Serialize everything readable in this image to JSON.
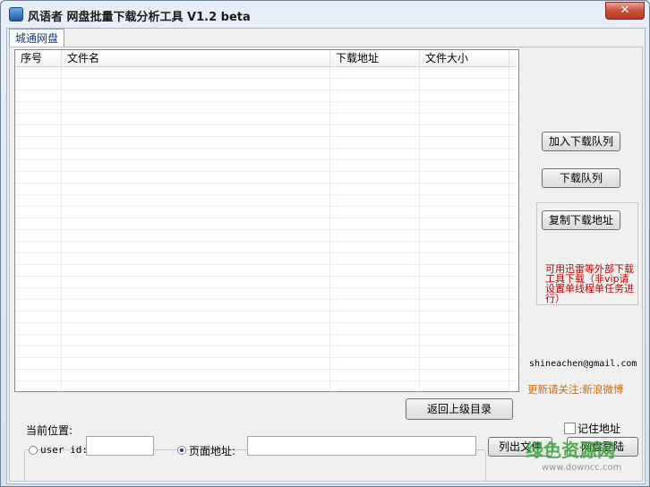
{
  "window": {
    "title": "风语者 网盘批量下载分析工具 V1.2 beta",
    "close_glyph": "✕"
  },
  "tabs": [
    {
      "label": "城通网盘"
    }
  ],
  "list": {
    "columns": [
      "序号",
      "文件名",
      "下载地址",
      "文件大小"
    ]
  },
  "buttons": {
    "add_queue": "加入下载队列",
    "download_queue": "下载队列",
    "copy_link": "复制下载地址",
    "back_up": "返回上级目录",
    "list_files": "列出文件",
    "login": "网盘登陆"
  },
  "note": "可用迅雷等外部下载工具下载（非vip请设置单线程单任务进行）",
  "email": "shineachen@gmail.com",
  "weibo": "更新请关注:新浪微博",
  "location_label": "当前位置:",
  "remember": {
    "label": "记住地址",
    "checked": false
  },
  "mode": {
    "user_id_label": "user id:",
    "user_id_value": "",
    "page_url_label": "页面地址:",
    "page_url_value": "",
    "selected": "page_url"
  },
  "watermark": {
    "main": "绿色资源网",
    "url": "www.downcc.com"
  },
  "colors": {
    "note_red": "#c00000",
    "weibo_orange": "#d46b00",
    "watermark_green": "#3aa53a"
  }
}
